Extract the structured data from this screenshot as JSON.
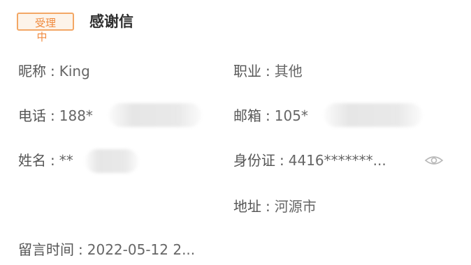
{
  "card": {
    "status_badge": "受理",
    "status_badge_wrap": "中",
    "title": "感谢信"
  },
  "fields": {
    "nickname": {
      "label": "昵称",
      "value": "King"
    },
    "occupation": {
      "label": "职业",
      "value": "其他"
    },
    "phone": {
      "label": "电话",
      "value": "188*"
    },
    "email": {
      "label": "邮箱",
      "value": "105*"
    },
    "name": {
      "label": "姓名",
      "value": "**"
    },
    "id_card": {
      "label": "身份证",
      "value": "4416*******..."
    },
    "address": {
      "label": "地址",
      "value": "河源市"
    },
    "message_time": {
      "label": "留言时间",
      "value": "2022-05-12 2..."
    }
  },
  "separator": ":",
  "icons": {
    "reveal": "eye-icon"
  },
  "colors": {
    "badge_border": "#f3a765",
    "badge_text": "#f08a3e",
    "title": "#2f2f2f",
    "text": "#555555"
  }
}
